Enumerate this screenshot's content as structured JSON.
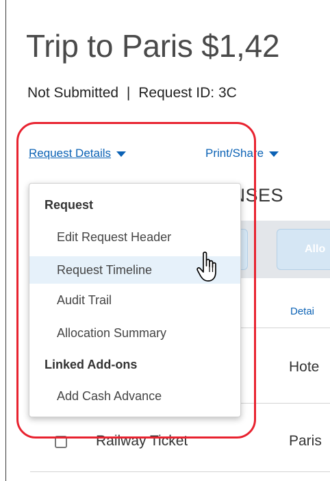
{
  "header": {
    "title": "Trip to Paris $1,42",
    "status": "Not Submitted",
    "separator": "|",
    "request_id": "Request ID: 3C"
  },
  "nav": {
    "request_details_label": "Request Details",
    "print_share_label": "Print/Share"
  },
  "expenses": {
    "heading": "ENSES",
    "toolbar_button_label": "Allo",
    "detail_column_header": "Detai",
    "rows": [
      {
        "detail": "Hote"
      },
      {
        "type": "Railway Ticket",
        "detail": "Paris"
      }
    ]
  },
  "request_menu": {
    "section_request": "Request",
    "items": [
      {
        "label": "Edit Request Header"
      },
      {
        "label": "Request Timeline",
        "hovered": true
      },
      {
        "label": "Audit Trail"
      },
      {
        "label": "Allocation Summary"
      }
    ],
    "section_linked": "Linked Add-ons",
    "linked_items": [
      {
        "label": "Add Cash Advance"
      }
    ]
  },
  "colors": {
    "link": "#0b62b5",
    "highlight_ring": "#e8222f",
    "menu_hover": "#e6f1fa",
    "toolbar_button": "#d5e6f4"
  },
  "icons": {
    "nav_caret": "caret-down-icon",
    "cursor": "hand-pointer-icon"
  }
}
